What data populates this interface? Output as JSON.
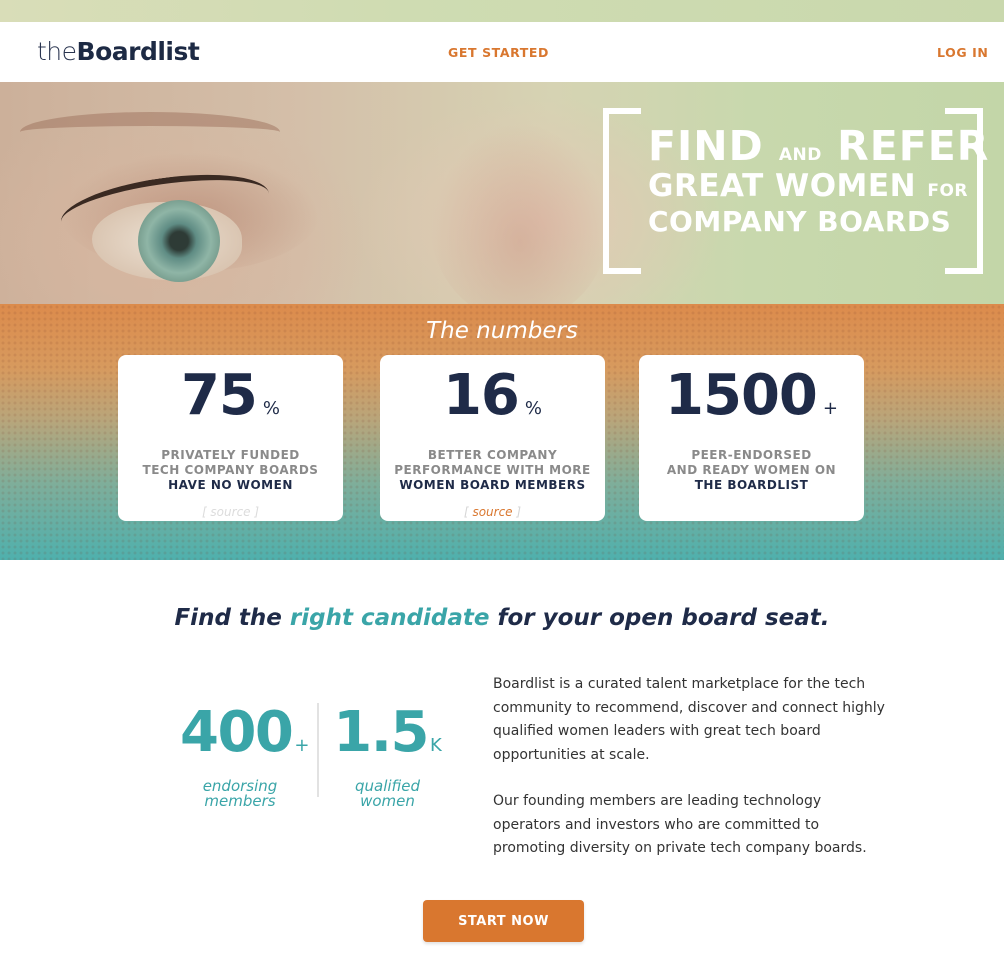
{
  "nav": {
    "logo_light": "the",
    "logo_bold": "Boardlist",
    "get_started": "GET STARTED",
    "login": "LOG IN"
  },
  "hero": {
    "find": "FIND",
    "and": "AND",
    "refer": "REFER",
    "great_women": "GREAT WOMEN",
    "for": "FOR",
    "company_boards": "COMPANY BOARDS"
  },
  "numbers": {
    "title": "The numbers",
    "cards": [
      {
        "value": "75",
        "suffix": "%",
        "line1": "PRIVATELY FUNDED",
        "line2": "TECH COMPANY BOARDS",
        "line3": "HAVE NO WOMEN",
        "source": "[ source ]"
      },
      {
        "value": "16",
        "suffix": "%",
        "line1": "BETTER COMPANY",
        "line2": "PERFORMANCE WITH MORE",
        "line3": "WOMEN BOARD MEMBERS",
        "source_open": "[",
        "source_link": "source",
        "source_close": "]"
      },
      {
        "value": "1500",
        "suffix": "+",
        "line1": "PEER-ENDORSED",
        "line2": "AND READY WOMEN ON",
        "line3": "THE BOARDLIST"
      }
    ]
  },
  "tagline": {
    "pre": "Find the",
    "accent": "right candidate",
    "post": "for your open board seat."
  },
  "stats": [
    {
      "value": "400",
      "suffix": "+",
      "label1": "endorsing",
      "label2": "members"
    },
    {
      "value": "1.5",
      "suffix": "K",
      "label1": "qualified",
      "label2": "women"
    }
  ],
  "description": {
    "p1": "Boardlist is a curated talent marketplace for the tech community to recommend, discover and connect highly qualified women leaders with great tech board opportunities at scale.",
    "p2": "Our founding members are leading technology operators and investors who are committed to promoting diversity on private tech company boards."
  },
  "cta": {
    "label": "START NOW"
  },
  "colors": {
    "accent_orange": "#d9772f",
    "accent_teal": "#3aa5a8",
    "navy": "#1f2b48"
  }
}
